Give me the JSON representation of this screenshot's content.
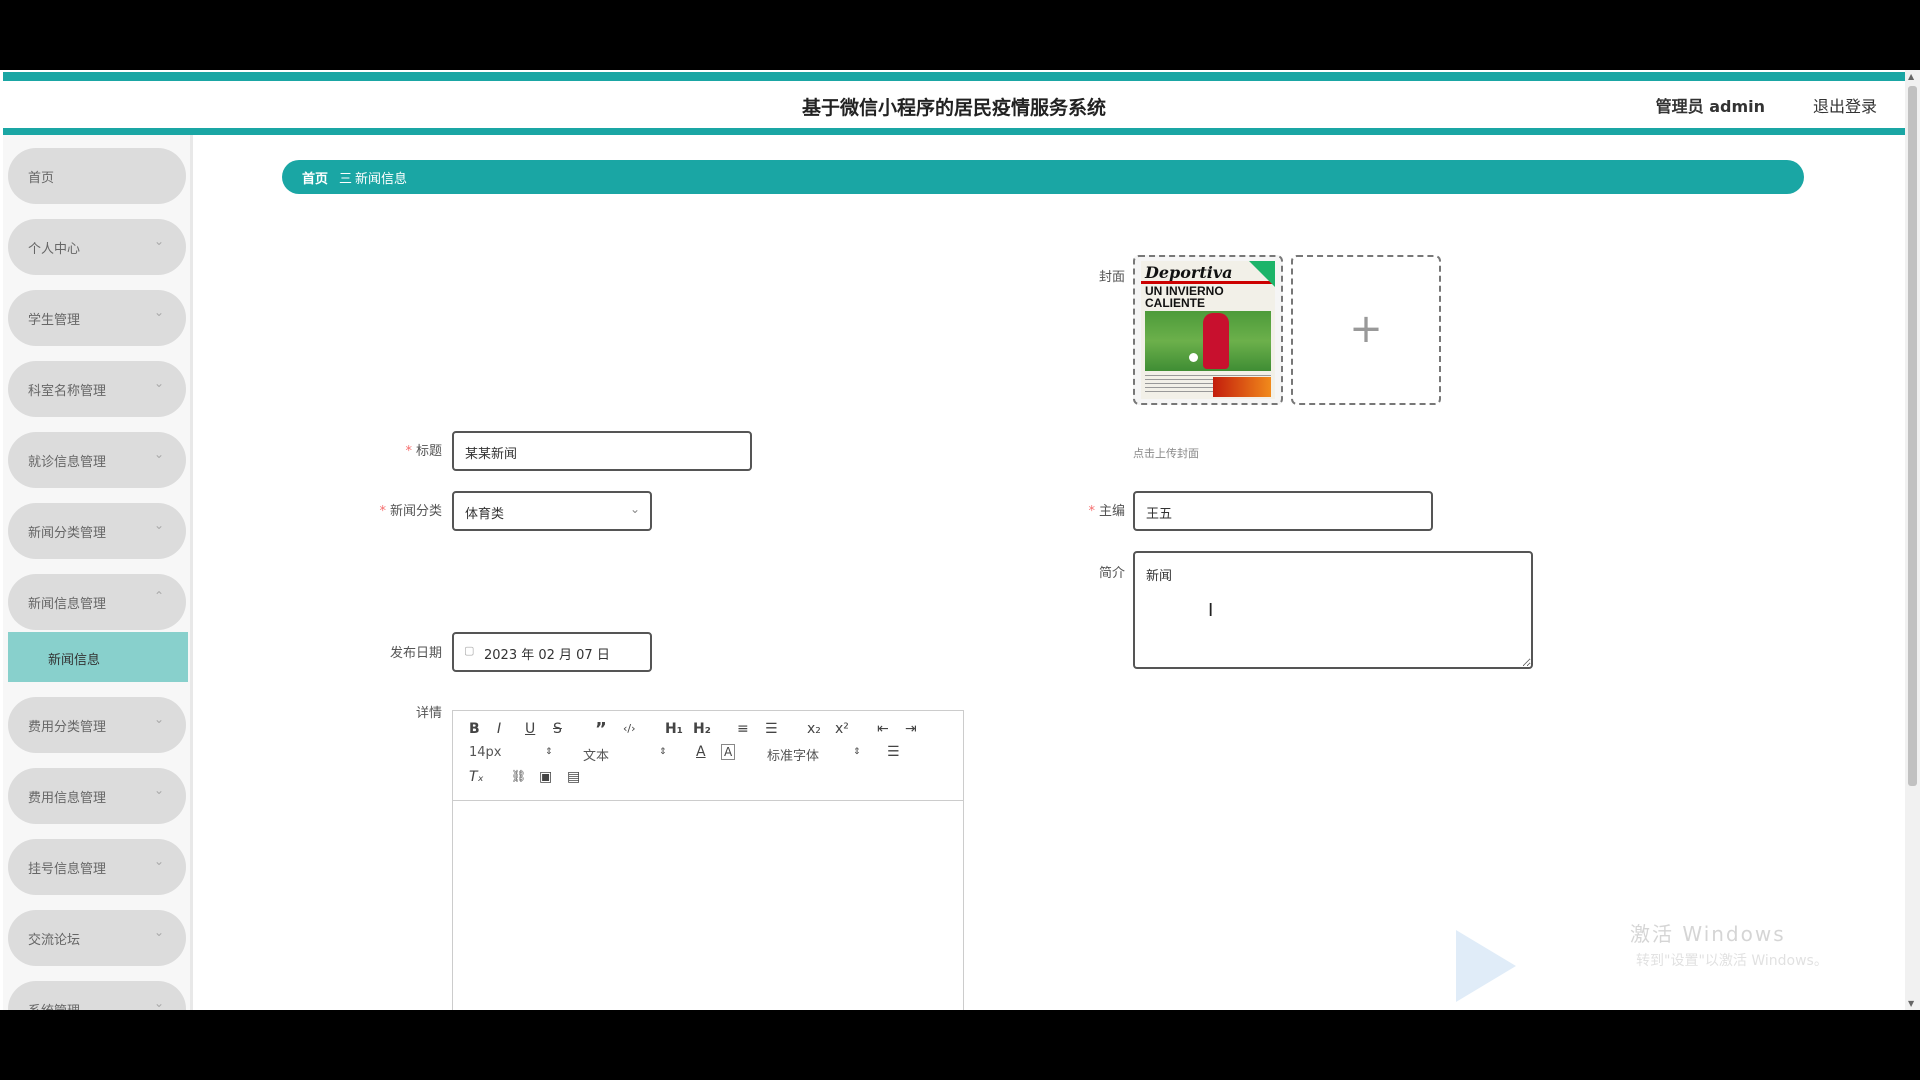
{
  "header": {
    "title": "基于微信小程序的居民疫情服务系统",
    "user": "管理员 admin",
    "logout": "退出登录"
  },
  "sidebar": {
    "items": [
      {
        "label": "首页",
        "has_chevron": false
      },
      {
        "label": "个人中心",
        "has_chevron": true
      },
      {
        "label": "学生管理",
        "has_chevron": true
      },
      {
        "label": "科室名称管理",
        "has_chevron": true
      },
      {
        "label": "就诊信息管理",
        "has_chevron": true
      },
      {
        "label": "新闻分类管理",
        "has_chevron": true
      },
      {
        "label": "新闻信息管理",
        "has_chevron": true,
        "expanded": true
      },
      {
        "label": "费用分类管理",
        "has_chevron": true
      },
      {
        "label": "费用信息管理",
        "has_chevron": true
      },
      {
        "label": "挂号信息管理",
        "has_chevron": true
      },
      {
        "label": "交流论坛",
        "has_chevron": true
      },
      {
        "label": "系统管理",
        "has_chevron": true
      }
    ],
    "submenu_active": "新闻信息"
  },
  "breadcrumb": {
    "home": "首页",
    "separator": "三",
    "current": "新闻信息"
  },
  "form": {
    "title_label": "标题",
    "title_value": "某某新闻",
    "category_label": "新闻分类",
    "category_value": "体育类",
    "publish_date_label": "发布日期",
    "publish_date_value": "2023 年 02 月 07 日",
    "detail_label": "详情",
    "cover_label": "封面",
    "cover_hint": "点击上传封面",
    "editor_label": "主编",
    "editor_value": "王五",
    "summary_label": "简介",
    "summary_value": "新闻",
    "cover_image_text": {
      "masthead": "Deportiva",
      "headline": "UN INVIERNO CALIENTE"
    }
  },
  "editor_toolbar": {
    "font_size": "14px",
    "block_type": "文本",
    "font_family": "标准字体",
    "row1": [
      "B",
      "I",
      "U",
      "S",
      "”",
      "‹/›",
      "H₁",
      "H₂",
      "≡",
      "☰",
      "x₂",
      "x²",
      "⇤",
      "⇥"
    ],
    "row3": [
      "Tₓ",
      "⛓",
      "▣",
      "▤"
    ]
  },
  "watermark": {
    "line1": "激活 Windows",
    "line2": "转到\"设置\"以激活 Windows。"
  },
  "colors": {
    "accent": "#1aa6a4",
    "submenu_active": "#88d0cc",
    "menu_bg": "#dcdcdc",
    "required": "#f56c6c"
  }
}
